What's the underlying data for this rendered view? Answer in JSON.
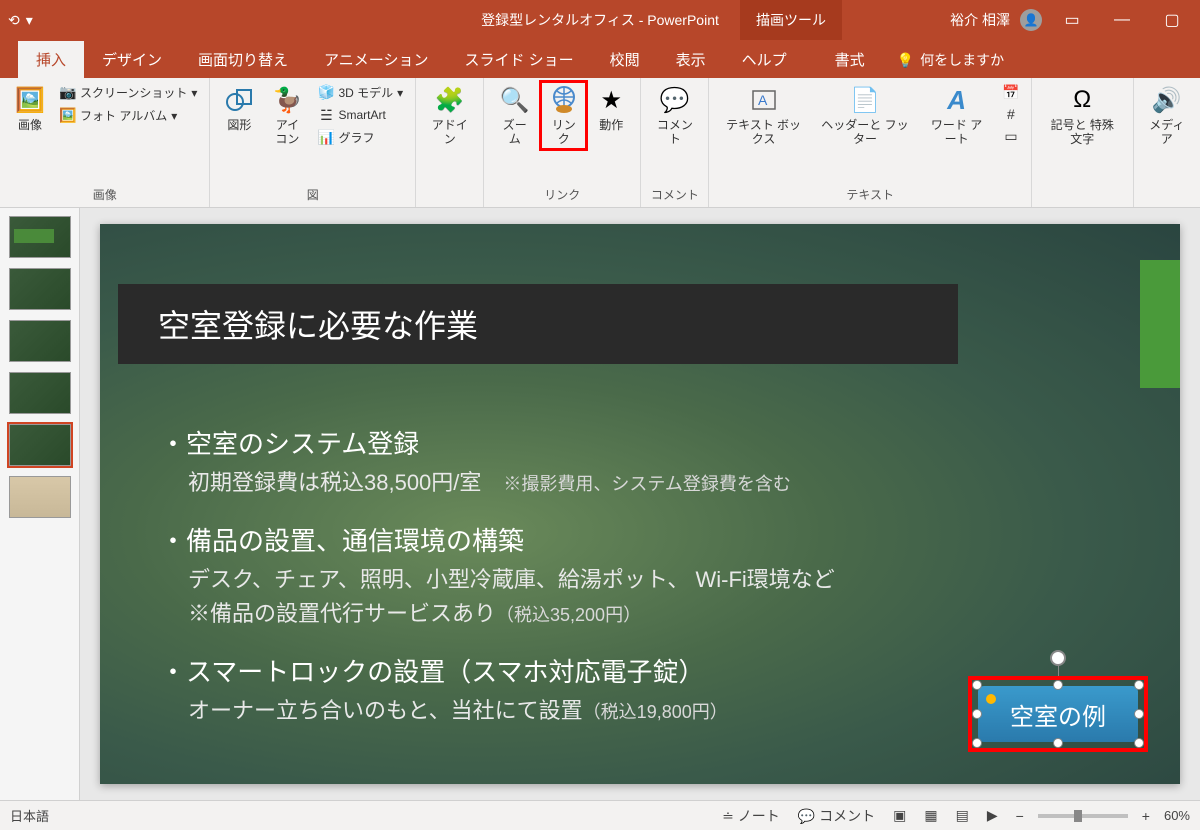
{
  "titlebar": {
    "doc_title": "登録型レンタルオフィス  -  PowerPoint",
    "tool_context": "描画ツール",
    "user_name": "裕介 相澤"
  },
  "tabs": {
    "items": [
      "挿入",
      "デザイン",
      "画面切り替え",
      "アニメーション",
      "スライド ショー",
      "校閲",
      "表示",
      "ヘルプ",
      "書式"
    ],
    "active_index": 0,
    "tellme_placeholder": "何をしますか"
  },
  "ribbon": {
    "images": {
      "label": "画像",
      "image": "画像",
      "screenshot": "スクリーンショット",
      "album": "フォト アルバム"
    },
    "illust": {
      "label": "図",
      "shapes": "図形",
      "icons": "アイコン",
      "model3d": "3D モデル",
      "smartart": "SmartArt",
      "chart": "グラフ"
    },
    "addins": {
      "label": "アドイン"
    },
    "links": {
      "label": "リンク",
      "zoom": "ズーム",
      "link": "リンク",
      "action": "動作"
    },
    "comments": {
      "label": "コメント",
      "comment": "コメント"
    },
    "text": {
      "label": "テキスト",
      "textbox": "テキスト ボックス",
      "headerfooter": "ヘッダーと フッター",
      "wordart": "ワード アート"
    },
    "symbols": {
      "label": "記号と 特殊文字"
    },
    "media": {
      "label": "メディア"
    }
  },
  "slide": {
    "title": "空室登録に必要な作業",
    "b1": "・空室のシステム登録",
    "b1_sub": "初期登録費は税込38,500円/室",
    "b1_note": "※撮影費用、システム登録費を含む",
    "b2": "・備品の設置、通信環境の構築",
    "b2_sub1": "デスク、チェア、照明、小型冷蔵庫、給湯ポット、 Wi-Fi環境など",
    "b2_sub2": "※備品の設置代行サービスあり",
    "b2_price": "（税込35,200円）",
    "b3": "・スマートロックの設置（スマホ対応電子錠）",
    "b3_sub": "オーナー立ち合いのもと、当社にて設置",
    "b3_price": "（税込19,800円）",
    "shape_label": "空室の例"
  },
  "status": {
    "lang": "日本語",
    "notes": "ノート",
    "comments": "コメント",
    "zoom": "60%"
  }
}
